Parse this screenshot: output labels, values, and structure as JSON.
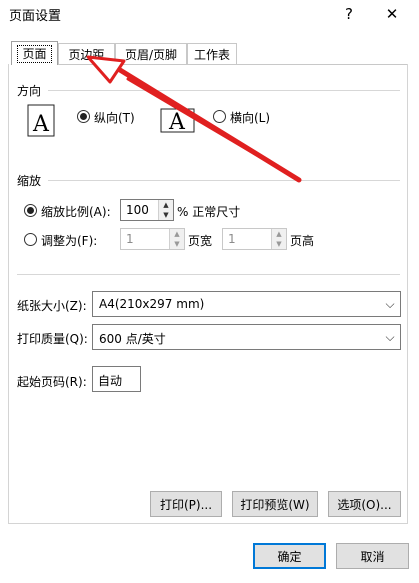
{
  "window": {
    "title": "页面设置",
    "help_glyph": "?",
    "close_glyph": "✕"
  },
  "tabs": [
    {
      "label": "页面",
      "active": true
    },
    {
      "label": "页边距",
      "active": false
    },
    {
      "label": "页眉/页脚",
      "active": false
    },
    {
      "label": "工作表",
      "active": false
    }
  ],
  "orientation": {
    "group_label": "方向",
    "portrait": {
      "label": "纵向(T)",
      "selected": true,
      "icon_glyph": "A"
    },
    "landscape": {
      "label": "横向(L)",
      "selected": false,
      "icon_glyph": "A"
    }
  },
  "scaling": {
    "group_label": "缩放",
    "adjust_to": {
      "label": "缩放比例(A):",
      "selected": true,
      "value": "100",
      "suffix": "% 正常尺寸"
    },
    "fit_to": {
      "label": "调整为(F):",
      "selected": false,
      "wide_value": "1",
      "wide_label": "页宽",
      "tall_value": "1",
      "tall_label": "页高"
    }
  },
  "paper_size": {
    "label": "纸张大小(Z):",
    "value": "A4(210x297 mm)"
  },
  "print_quality": {
    "label": "打印质量(Q):",
    "value": "600 点/英寸"
  },
  "first_page": {
    "label": "起始页码(R):",
    "value": "自动"
  },
  "buttons": {
    "print": "打印(P)...",
    "print_preview": "打印预览(W)",
    "options": "选项(O)...",
    "ok": "确定",
    "cancel": "取消"
  },
  "colors": {
    "annotation_arrow": "#e02020",
    "default_button_border": "#0078d7"
  }
}
